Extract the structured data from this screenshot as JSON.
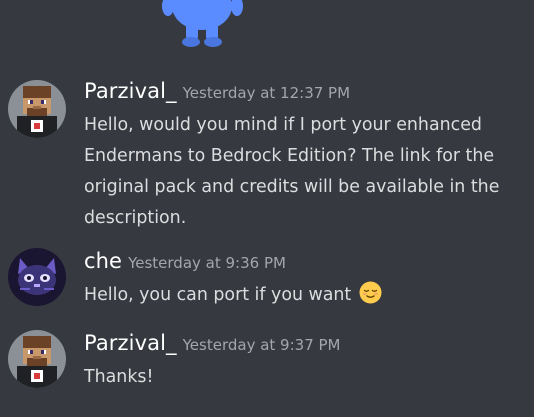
{
  "messages": [
    {
      "username": "Parzival_",
      "timestamp": "Yesterday at 12:37 PM",
      "text": "Hello, would you mind if I port your enhanced Endermans to Bedrock Edition? The link for the original pack and credits will be available in the description.",
      "avatar": "pixel-steve-avatar"
    },
    {
      "username": "che",
      "timestamp": "Yesterday at 9:36 PM",
      "text": "Hello, you can port if you want",
      "emoji": "relieved-face-emoji",
      "avatar": "pixel-cat-avatar"
    },
    {
      "username": "Parzival_",
      "timestamp": "Yesterday at 9:37 PM",
      "text": "Thanks!",
      "avatar": "pixel-steve-avatar"
    }
  ],
  "colors": {
    "background": "#36393f",
    "username": "#ffffff",
    "timestamp": "#a3a6aa",
    "message_text": "#dcddde",
    "mascot": "#5b8cff"
  }
}
